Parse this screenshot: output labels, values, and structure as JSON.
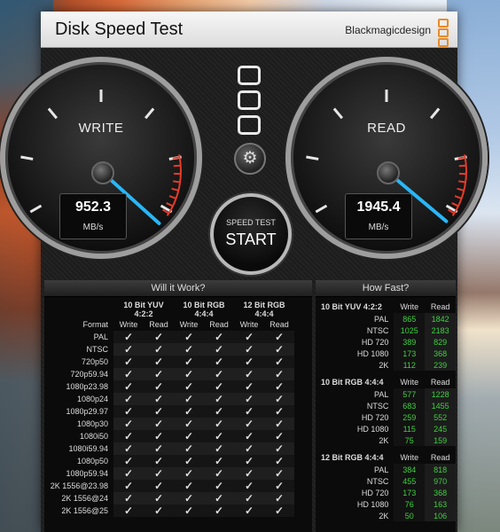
{
  "app": {
    "title": "Disk Speed Test",
    "brand": "Blackmagicdesign"
  },
  "gauges": {
    "write": {
      "label": "WRITE",
      "value": "952.3",
      "unit": "MB/s"
    },
    "read": {
      "label": "READ",
      "value": "1945.4",
      "unit": "MB/s"
    }
  },
  "start_button": {
    "line1": "SPEED TEST",
    "line2": "START"
  },
  "will_it_work": {
    "header": "Will it Work?",
    "format_label": "Format",
    "groups": [
      "10 Bit YUV 4:2:2",
      "10 Bit RGB 4:4:4",
      "12 Bit RGB 4:4:4"
    ],
    "subheaders": [
      "Write",
      "Read"
    ],
    "formats": [
      "PAL",
      "NTSC",
      "720p50",
      "720p59.94",
      "1080p23.98",
      "1080p24",
      "1080p29.97",
      "1080p30",
      "1080i50",
      "1080i59.94",
      "1080p50",
      "1080p59.94",
      "2K 1556@23.98",
      "2K 1556@24",
      "2K 1556@25"
    ],
    "check_symbol": "✓"
  },
  "how_fast": {
    "header": "How Fast?",
    "sections": [
      {
        "name": "10 Bit YUV 4:2:2",
        "write_label": "Write",
        "read_label": "Read",
        "rows": [
          {
            "label": "PAL",
            "write": "865",
            "read": "1842"
          },
          {
            "label": "NTSC",
            "write": "1025",
            "read": "2183"
          },
          {
            "label": "HD 720",
            "write": "389",
            "read": "829"
          },
          {
            "label": "HD 1080",
            "write": "173",
            "read": "368"
          },
          {
            "label": "2K",
            "write": "112",
            "read": "239"
          }
        ]
      },
      {
        "name": "10 Bit RGB 4:4:4",
        "write_label": "Write",
        "read_label": "Read",
        "rows": [
          {
            "label": "PAL",
            "write": "577",
            "read": "1228"
          },
          {
            "label": "NTSC",
            "write": "683",
            "read": "1455"
          },
          {
            "label": "HD 720",
            "write": "259",
            "read": "552"
          },
          {
            "label": "HD 1080",
            "write": "115",
            "read": "245"
          },
          {
            "label": "2K",
            "write": "75",
            "read": "159"
          }
        ]
      },
      {
        "name": "12 Bit RGB 4:4:4",
        "write_label": "Write",
        "read_label": "Read",
        "rows": [
          {
            "label": "PAL",
            "write": "384",
            "read": "818"
          },
          {
            "label": "NTSC",
            "write": "455",
            "read": "970"
          },
          {
            "label": "HD 720",
            "write": "173",
            "read": "368"
          },
          {
            "label": "HD 1080",
            "write": "76",
            "read": "163"
          },
          {
            "label": "2K",
            "write": "50",
            "read": "106"
          }
        ]
      }
    ]
  },
  "icons": {
    "settings": "gear-icon",
    "brand_logo": "blackmagic-logo-icon"
  },
  "colors": {
    "needle": "#29b6f6",
    "redline": "#e53b2a",
    "check": "#3fbf2f",
    "value_green": "#3fcf3f",
    "logo_orange": "#e98b2a"
  }
}
